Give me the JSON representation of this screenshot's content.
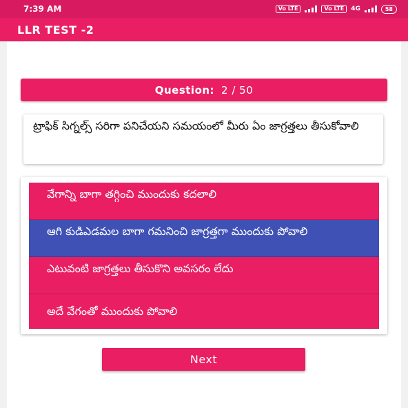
{
  "status_bar": {
    "time": "7:39 AM",
    "volte_1": "Vo LTE",
    "volte_2": "Vo LTE",
    "network": "4G",
    "battery": "58"
  },
  "app_bar": {
    "title": "LLR TEST -2"
  },
  "question": {
    "label": "Question:",
    "counter": "2 / 50",
    "text": "ట్రాఫిక్ సిగ్నల్స్ సరిగా పనిచేయని సమయంలో మీరు ఏం జాగ్రత్తలు తీసుకోవాలి"
  },
  "options": [
    {
      "text": "వేగాన్ని బాగా తగ్గించి ముందుకు కదలాలి",
      "selected": false
    },
    {
      "text": "ఆగి కుడిఎడమల బాగా గమనించి జాగ్రత్తగా ముందుకు పోవాలి",
      "selected": true
    },
    {
      "text": "ఎటువంటి జాగ్రత్తలు తీసుకొని అవసరం లేదు",
      "selected": false
    },
    {
      "text": "అదే వేగంతో ముందుకు పోవాలి",
      "selected": false
    }
  ],
  "next_label": "Next",
  "colors": {
    "status_bar": "#d81b60",
    "primary": "#e91e63",
    "selected_option": "#3f51b5",
    "background": "#ffffff"
  }
}
